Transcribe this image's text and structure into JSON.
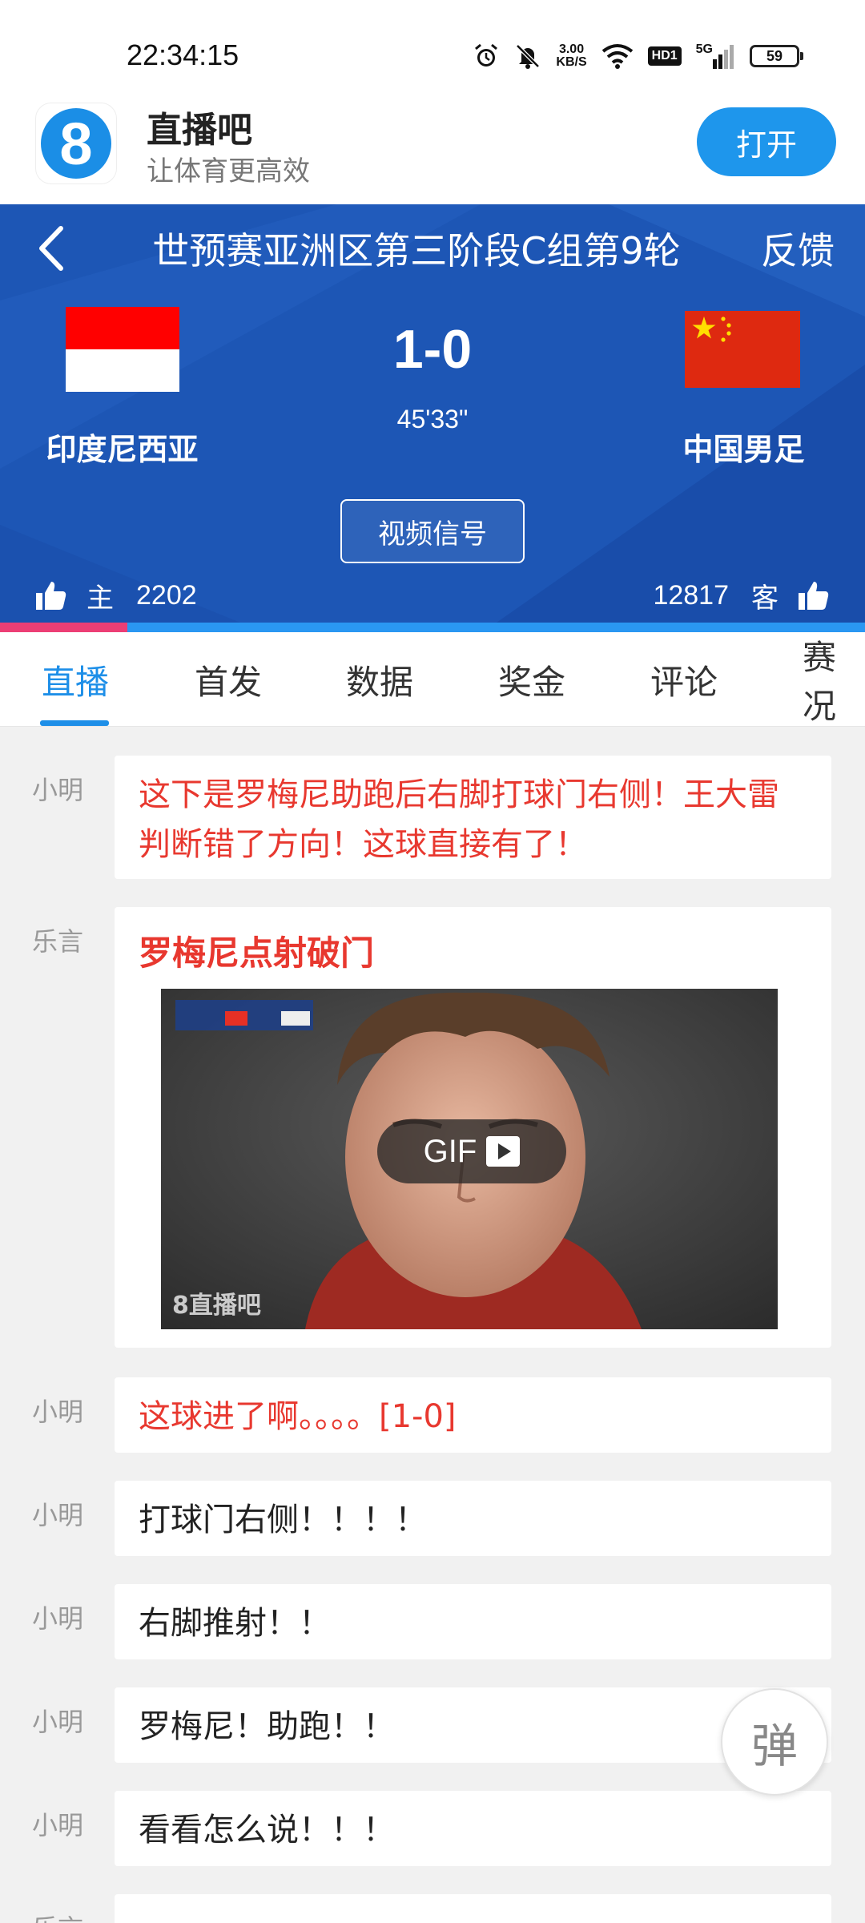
{
  "status_bar": {
    "time": "22:34:15",
    "net_speed_value": "3.00",
    "net_speed_unit": "KB/S",
    "hd_label": "HD1",
    "signal_label": "5G",
    "battery": "59",
    "icons": [
      "alarm-icon",
      "mute-icon",
      "wifi-icon",
      "signal-icon",
      "battery-icon"
    ]
  },
  "app_banner": {
    "logo_text": "8",
    "name": "直播吧",
    "slogan": "让体育更高效",
    "open_label": "打开",
    "accent": "#1e96ec"
  },
  "match": {
    "title": "世预赛亚洲区第三阶段C组第9轮",
    "feedback_label": "反馈",
    "score": "1-0",
    "clock": "45'33\"",
    "video_signal_label": "视频信号",
    "home": {
      "name": "印度尼西亚",
      "like_label": "主",
      "likes": "2202"
    },
    "away": {
      "name": "中国男足",
      "like_label": "客",
      "likes": "12817"
    },
    "home_support_share": 0.147,
    "header_color": "#1d56b5",
    "home_bar_color": "#ec3e75",
    "away_bar_color": "#2a97f2"
  },
  "tabs": [
    {
      "label": "直播",
      "active": true
    },
    {
      "label": "首发",
      "active": false
    },
    {
      "label": "数据",
      "active": false
    },
    {
      "label": "奖金",
      "active": false
    },
    {
      "label": "评论",
      "active": false
    },
    {
      "label": "赛况",
      "active": false
    }
  ],
  "feed": [
    {
      "author": "小明",
      "text": "这下是罗梅尼助跑后右脚打球门右侧！王大雷判断错了方向！这球直接有了！",
      "highlight": true
    },
    {
      "author": "乐言",
      "title": "罗梅尼点射破门",
      "media_label": "GIF",
      "media_watermark": "8直播吧"
    },
    {
      "author": "小明",
      "text": "这球进了啊。。。。[1-0]",
      "highlight": true
    },
    {
      "author": "小明",
      "text": "打球门右侧！！！！",
      "highlight": false
    },
    {
      "author": "小明",
      "text": "右脚推射！！",
      "highlight": false
    },
    {
      "author": "小明",
      "text": "罗梅尼！助跑！！",
      "highlight": false
    },
    {
      "author": "小明",
      "text": "看看怎么说！！！",
      "highlight": false
    },
    {
      "author": "乐言",
      "text": "",
      "highlight": false
    }
  ],
  "danmaku_label": "弹"
}
